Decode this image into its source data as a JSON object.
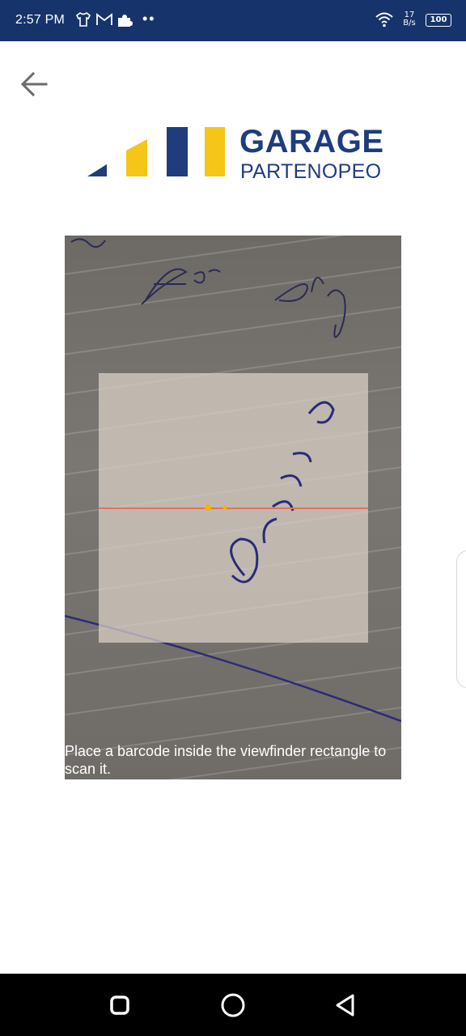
{
  "status_bar": {
    "time": "2:57 PM",
    "notification_icons": [
      "tshirt-icon",
      "gmail-icon",
      "puzzle-icon"
    ],
    "more_dots": "••",
    "network_speed_value": "17",
    "network_speed_unit": "B/s",
    "battery": "100",
    "wifi_icon": "wifi-icon"
  },
  "header": {
    "back_icon": "arrow-left-icon",
    "logo_title": "GARAGE",
    "logo_subtitle": "PARTENOPEO",
    "brand_colors": {
      "navy": "#1f3c7d",
      "yellow": "#f5c518"
    }
  },
  "scanner": {
    "hint": "Place a barcode inside the viewfinder rectangle to scan it.",
    "laser_color": "#e07260"
  },
  "nav_bar": {
    "recents_icon": "square-icon",
    "home_icon": "circle-icon",
    "back_icon": "triangle-back-icon"
  },
  "colors": {
    "status_bar_bg": "#16336b",
    "nav_bar_bg": "#000000"
  }
}
